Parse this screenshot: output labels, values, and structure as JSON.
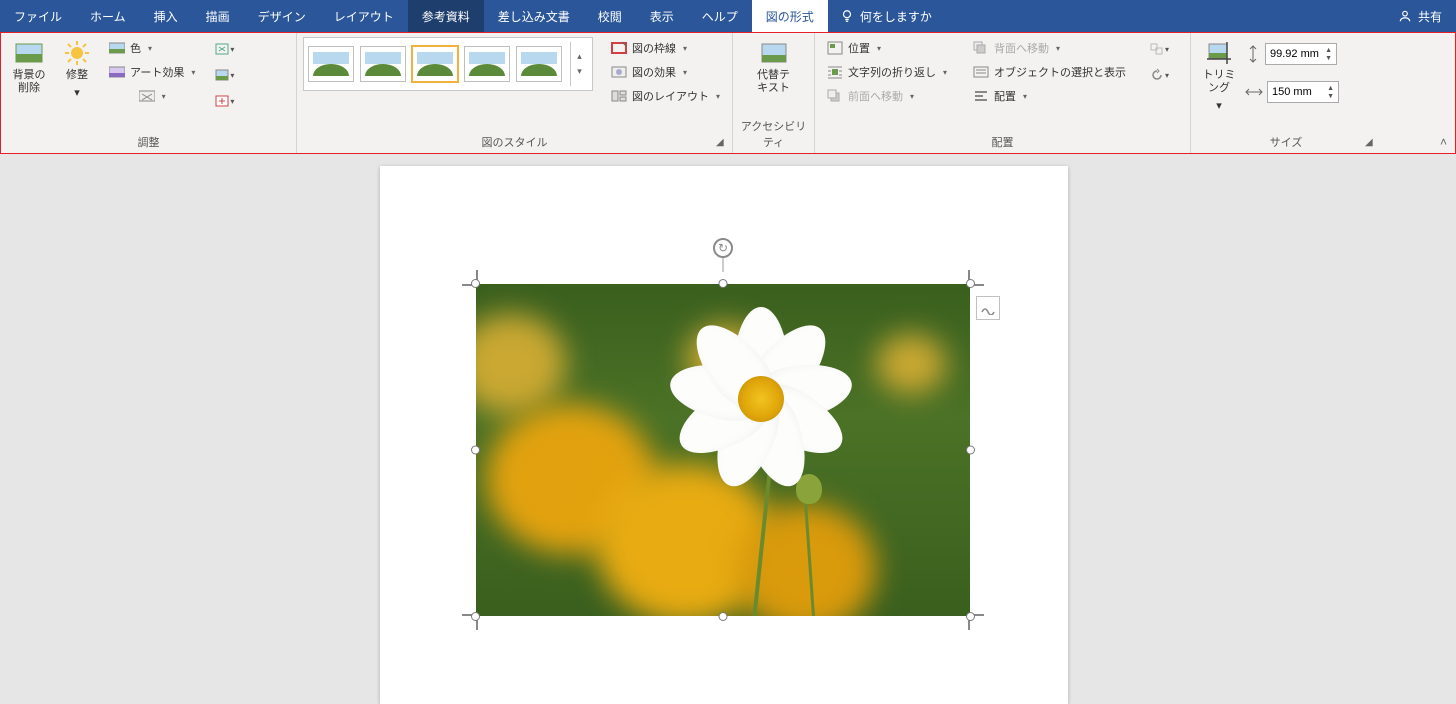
{
  "menu": {
    "tabs": [
      "ファイル",
      "ホーム",
      "挿入",
      "描画",
      "デザイン",
      "レイアウト",
      "参考資料",
      "差し込み文書",
      "校閲",
      "表示",
      "ヘルプ"
    ],
    "context_tab": "図の形式",
    "tell_me": "何をしますか",
    "share": "共有",
    "active_index": 6
  },
  "ribbon": {
    "adjust": {
      "remove_bg_l1": "背景の",
      "remove_bg_l2": "削除",
      "corrections": "修整",
      "color": "色",
      "artistic": "アート効果",
      "label": "調整"
    },
    "styles": {
      "label": "図のスタイル",
      "border": "図の枠線",
      "effects": "図の効果",
      "layout": "図のレイアウト"
    },
    "access": {
      "alt_l1": "代替テ",
      "alt_l2": "キスト",
      "label": "アクセシビリティ"
    },
    "arrange": {
      "position": "位置",
      "wrap": "文字列の折り返し",
      "bring_fwd": "前面へ移動",
      "send_back": "背面へ移動",
      "selection_pane": "オブジェクトの選択と表示",
      "align": "配置",
      "label": "配置"
    },
    "size": {
      "crop": "トリミング",
      "height": "99.92 mm",
      "width": "150 mm",
      "label": "サイズ"
    }
  }
}
